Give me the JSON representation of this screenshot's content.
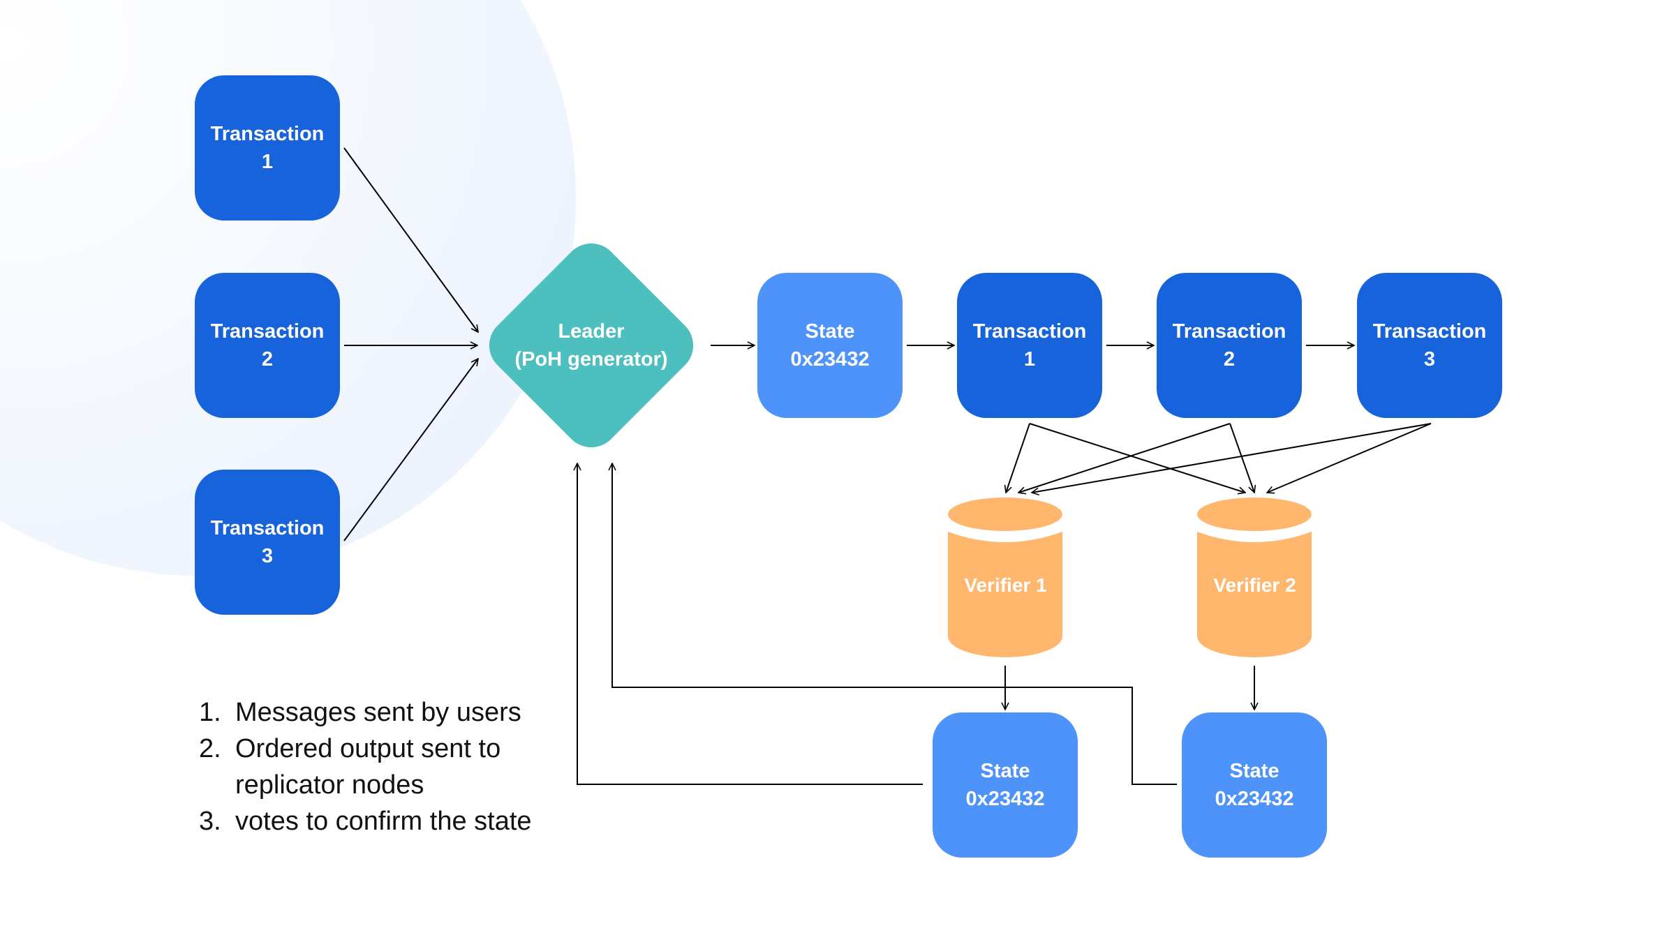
{
  "colors": {
    "transaction": "#1763dc",
    "state": "#4d93fa",
    "leader": "#4dbfbe",
    "verifier": "#ffb76e",
    "arrow": "#000000"
  },
  "input_transactions": [
    {
      "title": "Transaction",
      "num": "1"
    },
    {
      "title": "Transaction",
      "num": "2"
    },
    {
      "title": "Transaction",
      "num": "3"
    }
  ],
  "leader": {
    "title": "Leader",
    "subtitle": "(PoH generator)"
  },
  "state_main": {
    "title": "State",
    "value": "0x23432"
  },
  "chain_transactions": [
    {
      "title": "Transaction",
      "num": "1"
    },
    {
      "title": "Transaction",
      "num": "2"
    },
    {
      "title": "Transaction",
      "num": "3"
    }
  ],
  "verifiers": [
    {
      "label": "Verifier 1"
    },
    {
      "label": "Verifier 2"
    }
  ],
  "verifier_states": [
    {
      "title": "State",
      "value": "0x23432"
    },
    {
      "title": "State",
      "value": "0x23432"
    }
  ],
  "legend": [
    {
      "num": "1.",
      "text": "Messages sent by users"
    },
    {
      "num": "2.",
      "text": "Ordered output sent to",
      "continuation": "replicator nodes"
    },
    {
      "num": "3.",
      "text": "votes to confirm the state"
    }
  ]
}
